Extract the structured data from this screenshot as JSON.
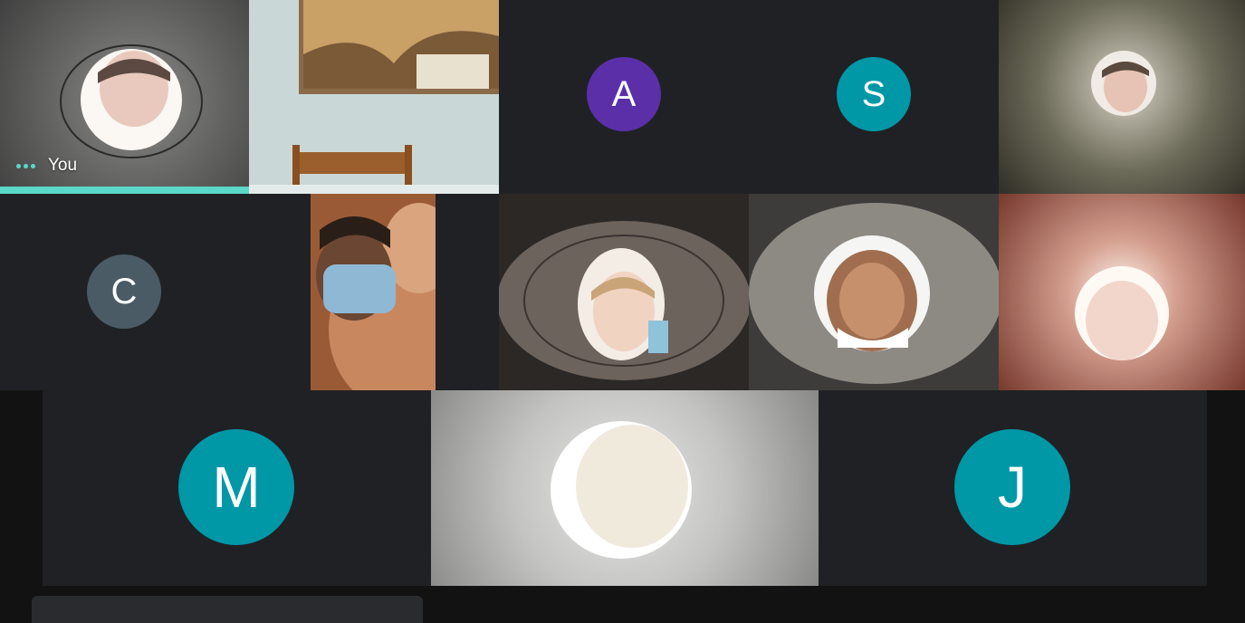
{
  "self_tile": {
    "label": "You"
  },
  "avatars": {
    "a": {
      "letter": "A",
      "color": "#5b2fa8"
    },
    "s": {
      "letter": "S",
      "color": "#0097a7"
    },
    "c": {
      "letter": "C",
      "color": "#4a5b66"
    },
    "m": {
      "letter": "M",
      "color": "#0097a7"
    },
    "j": {
      "letter": "J",
      "color": "#0097a7"
    }
  },
  "colors": {
    "speaking_indicator": "#5bd8c9",
    "tile_background": "#202124",
    "page_background": "#121212"
  }
}
